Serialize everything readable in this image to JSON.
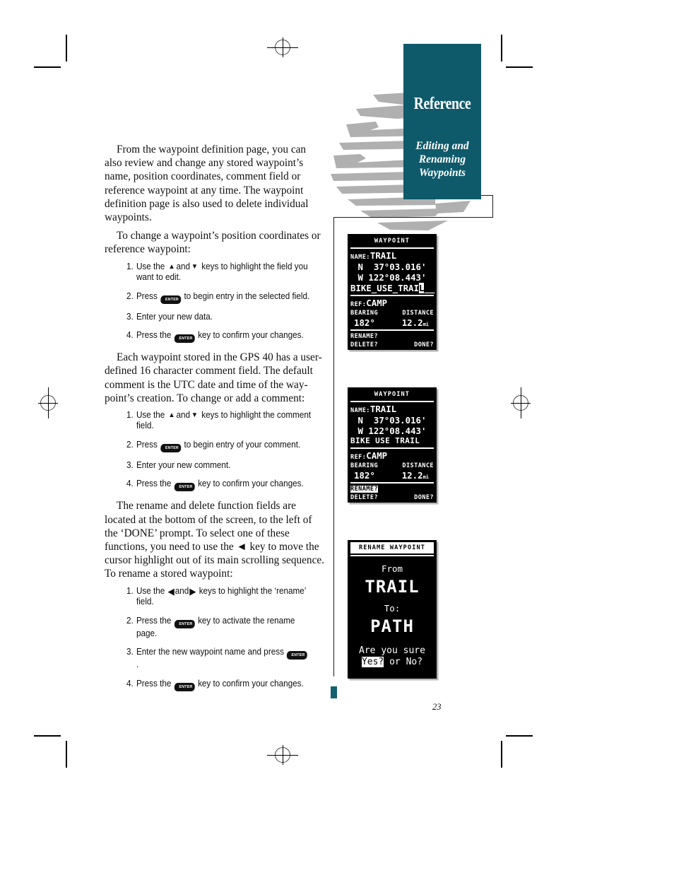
{
  "header": {
    "tab_title": "Reference",
    "subtitle_lines": [
      "Editing and",
      "Renaming",
      "Waypoints"
    ],
    "teal": "#0e5a6b"
  },
  "page_number": "23",
  "body": {
    "paragraphs": [
      "From the waypoint definition page, you can also review and change any stored waypoint’s name, position coordinates, comment field or reference waypoint at any time. The waypoint definition page is also used to delete individual waypoints.",
      "To change a waypoint’s position coordinates or reference waypoint:",
      "Each waypoint stored in the GPS 40 has a user-defined 16 character comment field. The default comment is the UTC date and time of the way-point’s creation. To change or add a comment:",
      "The rename and delete function fields are located at the bottom of the screen, to the left of the ‘DONE’ prompt. To select one of these functions, you need to use the ◄ key to move the cursor highlight out of its main scrolling sequence. To rename a stored waypoint:"
    ],
    "steps_group1": [
      {
        "num": "1.",
        "before": "Use the ",
        "after": " keys to highlight the field you want to edit.",
        "arrows": "up-down"
      },
      {
        "num": "2.",
        "before": "Press ",
        "after": " to begin entry in the selected field.",
        "key": "ENTER"
      },
      {
        "num": "3.",
        "before": "Enter your new data.",
        "after": ""
      },
      {
        "num": "4.",
        "before": "Press the ",
        "after": " key to confirm your changes.",
        "key": "ENTER"
      }
    ],
    "steps_group2": [
      {
        "num": "1.",
        "before": "Use the ",
        "after": " keys to highlight the comment field.",
        "arrows": "up-down"
      },
      {
        "num": "2.",
        "before": "Press ",
        "after": " to begin entry of your comment.",
        "key": "ENTER"
      },
      {
        "num": "3.",
        "before": "Enter your new comment.",
        "after": ""
      },
      {
        "num": "4.",
        "before": "Press the ",
        "after": " key to confirm your changes.",
        "key": "ENTER"
      }
    ],
    "steps_group3": [
      {
        "num": "1.",
        "before": "Use the ",
        "after": " keys to highlight the ‘rename’ field.",
        "arrows": "left-right"
      },
      {
        "num": "2.",
        "before": "Press the ",
        "after": " key to activate the rename page.",
        "key": "ENTER"
      },
      {
        "num": "3.",
        "before": "Enter the new waypoint name and press ",
        "after": " .",
        "key": "ENTER"
      },
      {
        "num": "4.",
        "before": "Press the ",
        "after": " key to confirm your changes.",
        "key": "ENTER"
      }
    ],
    "and_word": "and",
    "key_label": "ENTER"
  },
  "screens": {
    "gps1": {
      "title": "WAYPOINT",
      "name_label": "NAME:",
      "name_value": "TRAIL",
      "lat": "N  37°03.016'",
      "lon": "W 122°08.443'",
      "comment_pre": "BIKE_USE_TRAI",
      "comment_cursor": "L",
      "comment_post": "__",
      "ref_label": "REF:",
      "ref_value": "CAMP",
      "bearing_header": "BEARING",
      "distance_header": "DISTANCE",
      "bearing_value": "182°",
      "distance_value": "12.2",
      "distance_unit": "mi",
      "rename_label": "RENAME?",
      "delete_label": "DELETE?",
      "done_label": "DONE?"
    },
    "gps2": {
      "title": "WAYPOINT",
      "name_label": "NAME:",
      "name_value": "TRAIL",
      "lat": "N  37°03.016'",
      "lon": "W 122°08.443'",
      "comment": "BIKE USE TRAIL",
      "ref_label": "REF:",
      "ref_value": "CAMP",
      "bearing_header": "BEARING",
      "distance_header": "DISTANCE",
      "bearing_value": "182°",
      "distance_value": "12.2",
      "distance_unit": "mi",
      "rename_label": "RENAME?",
      "delete_label": "DELETE?",
      "done_label": "DONE?"
    },
    "gps3": {
      "title": "RENAME WAYPOINT",
      "from_label": "From",
      "from_value": "TRAIL",
      "to_label": "To:",
      "to_value": "PATH",
      "confirm_prompt": "Are you sure",
      "yes_label": "Yes?",
      "or_label": " or ",
      "no_label": "No?"
    }
  }
}
